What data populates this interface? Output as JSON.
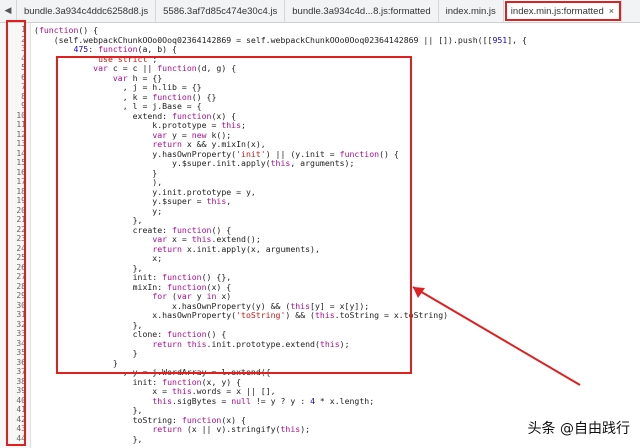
{
  "tabs": [
    {
      "label": "bundle.3a934c4ddc6258d8.js",
      "active": false
    },
    {
      "label": "5586.3af7d85c474e30c4.js",
      "active": false
    },
    {
      "label": "bundle.3a934c4d...8.js:formatted",
      "active": false
    },
    {
      "label": "index.min.js",
      "active": false
    },
    {
      "label": "index.min.js:formatted",
      "active": true
    }
  ],
  "close_glyph": "×",
  "code_lines": [
    "(function() {",
    "    (self.webpackChunkOOo0Ooq02364142869 = self.webpackChunkOOo0Ooq02364142869 || []).push([[951], {",
    "        475: function(a, b) {",
    "            \"use strict\";",
    "            var c = c || function(d, g) {",
    "                var h = {}",
    "                  , j = h.lib = {}",
    "                  , k = function() {}",
    "                  , l = j.Base = {",
    "                    extend: function(x) {",
    "                        k.prototype = this;",
    "                        var y = new k();",
    "                        return x && y.mixIn(x),",
    "                        y.hasOwnProperty('init') || (y.init = function() {",
    "                            y.$super.init.apply(this, arguments);",
    "                        }",
    "                        ),",
    "                        y.init.prototype = y,",
    "                        y.$super = this,",
    "                        y;",
    "                    },",
    "                    create: function() {",
    "                        var x = this.extend();",
    "                        return x.init.apply(x, arguments),",
    "                        x;",
    "                    },",
    "                    init: function() {},",
    "                    mixIn: function(x) {",
    "                        for (var y in x)",
    "                            x.hasOwnProperty(y) && (this[y] = x[y]);",
    "                        x.hasOwnProperty('toString') && (this.toString = x.toString)",
    "                    },",
    "                    clone: function() {",
    "                        return this.init.prototype.extend(this);",
    "                    }",
    "                }",
    "                  , y = j.WordArray = l.extend({",
    "                    init: function(x, y) {",
    "                        x = this.words = x || [],",
    "                        this.sigBytes = null != y ? y : 4 * x.length;",
    "                    },",
    "                    toString: function(x) {",
    "                        return (x || v).stringify(this);",
    "                    },"
  ],
  "watermark": "头条 @自由践行"
}
